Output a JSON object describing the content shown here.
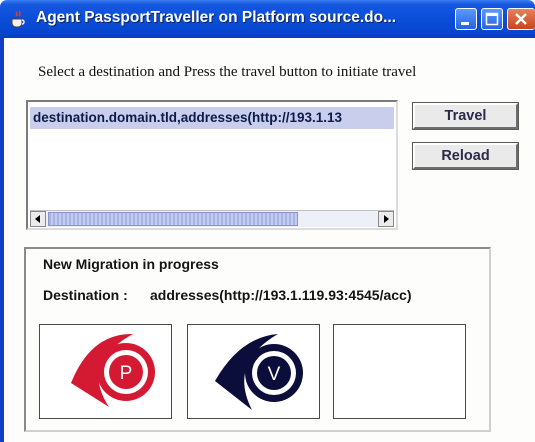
{
  "window": {
    "title": "Agent PassportTraveller on Platform source.do..."
  },
  "instruction": "Select a destination and Press the travel button to initiate travel",
  "destinations": {
    "items": [
      "destination.domain.tld,addresses(http://193.1.13"
    ]
  },
  "buttons": {
    "travel": "Travel",
    "reload": "Reload"
  },
  "migration": {
    "title": "New Migration in progress",
    "destination_label": "Destination :",
    "destination_value": "addresses(http://193.1.119.93:4545/acc)",
    "icons": [
      {
        "name": "passport-icon",
        "letter": "P",
        "color": "#d41a32"
      },
      {
        "name": "visa-icon",
        "letter": "V",
        "color": "#0b0e3a"
      }
    ]
  },
  "colors": {
    "titlebar": "#0a4ed8",
    "selection": "#c8ceec",
    "passport": "#d41a32",
    "visa": "#0b0e3a"
  }
}
